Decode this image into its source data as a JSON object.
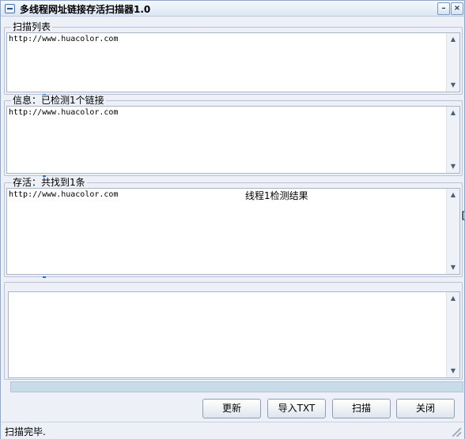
{
  "window": {
    "title": "多线程网址链接存活扫描器1.0",
    "minimize_glyph": "–",
    "close_glyph": "×"
  },
  "scan_list": {
    "label": "扫描列表",
    "lines": [
      "http://www.huacolor.com"
    ]
  },
  "info": {
    "label": "信息：已检测1个链接",
    "lines": [
      "http://www.huacolor.com"
    ]
  },
  "alive": {
    "label": "存活：共找到1条",
    "lines": [
      "http://www.huacolor.com"
    ],
    "overlay_text": "线程1检测结果",
    "stray_glyph": "["
  },
  "log": {
    "lines": []
  },
  "progress": {
    "value": 0
  },
  "buttons": {
    "update": "更新",
    "import_txt": "导入TXT",
    "scan": "扫描",
    "close": "关闭"
  },
  "status": {
    "text": "扫描完毕."
  },
  "icons": {
    "app": "app-icon",
    "scroll_up": "▲",
    "scroll_down": "▼"
  },
  "colors": {
    "window_bg": "#edf1f7",
    "progress_bg": "#c7dbe8"
  }
}
